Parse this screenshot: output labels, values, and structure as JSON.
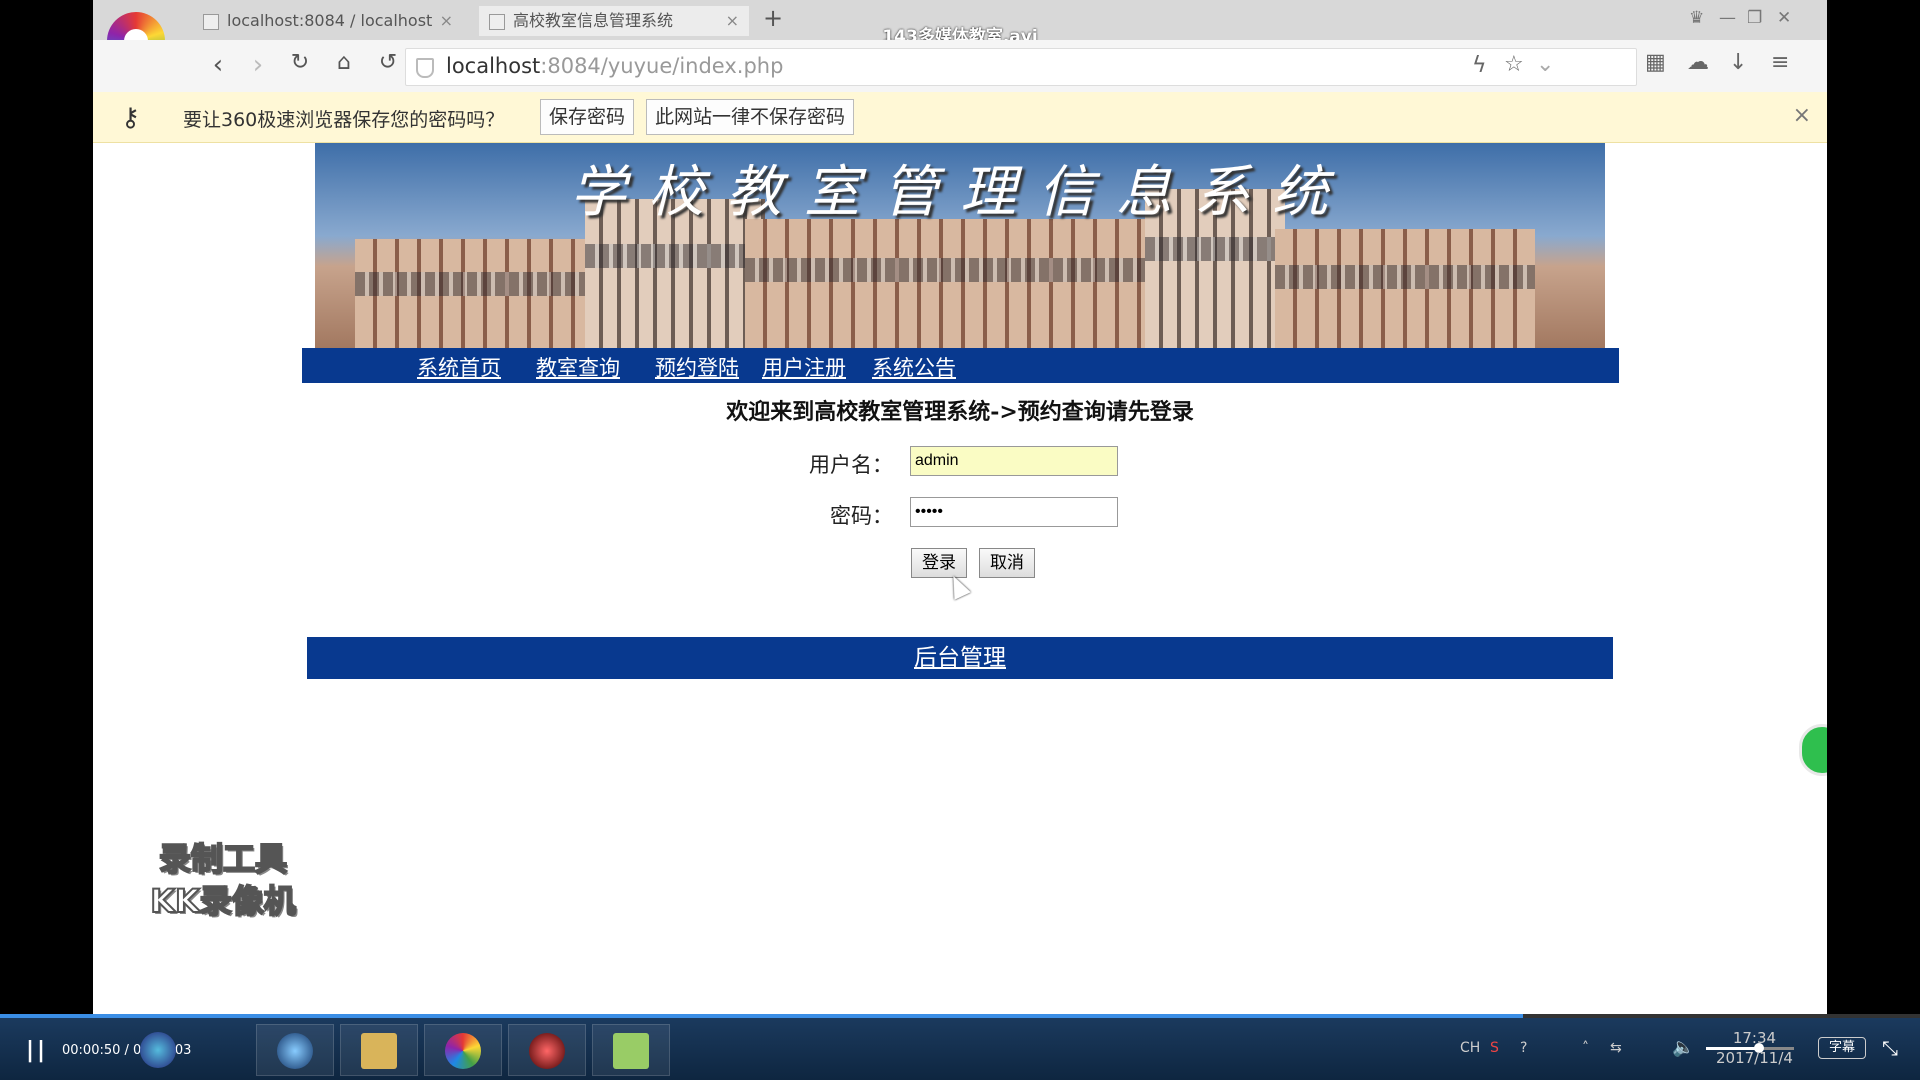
{
  "video": {
    "title": "143多媒体教室.avi",
    "time": "00:00:50 / 00:01:03",
    "progress": 0.793,
    "volume": 0.6,
    "subtitle_btn": "字幕"
  },
  "browser": {
    "tabs": [
      {
        "label": "localhost:8084 / localhost",
        "close": "×"
      },
      {
        "label": "高校教室信息管理系统",
        "close": "×"
      }
    ],
    "new_tab": "+",
    "url_host": "localhost",
    "url_rest": ":8084/yuyue/index.php"
  },
  "password_bar": {
    "prompt": "要让360极速浏览器保存您的密码吗？",
    "save_label": "保存密码",
    "never_label": "此网站一律不保存密码",
    "close": "×"
  },
  "page": {
    "banner_title": "学校教室管理信息系统",
    "nav": [
      "系统首页",
      "教室查询",
      "预约登陆",
      "用户注册",
      "系统公告"
    ],
    "welcome": "欢迎来到高校教室管理系统->预约查询请先登录",
    "username_label": "用户名：",
    "username_value": "admin",
    "password_label": "密码：",
    "password_value": "•••••",
    "login_label": "登录",
    "cancel_label": "取消",
    "footer_link": "后台管理"
  },
  "watermark": {
    "line1": "录制工具",
    "line2": "KK录像机"
  },
  "taskbar": {
    "tray_lang": "CH",
    "clock_time": "17:34",
    "clock_date": "2017/11/4"
  },
  "colors": {
    "nav_bg": "#08398f",
    "pw_bar": "#fff8d6",
    "progress": "#3a8ee6"
  }
}
